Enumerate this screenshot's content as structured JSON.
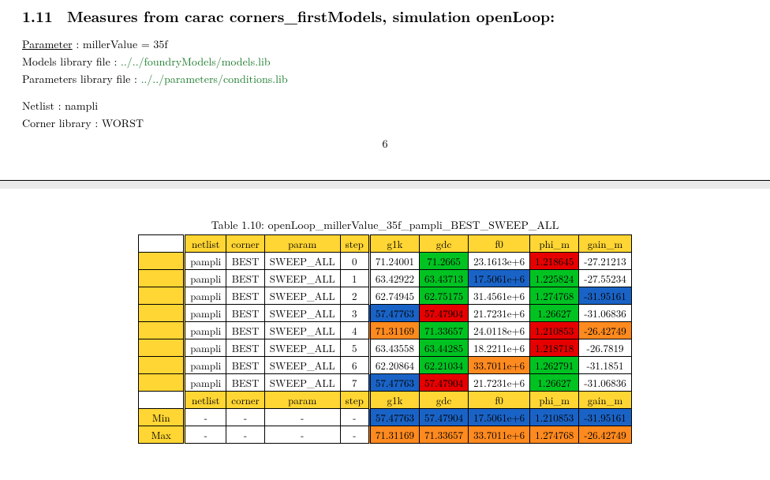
{
  "section": {
    "number": "1.11",
    "title": "Measures from carac corners_firstModels, simulation openLoop:"
  },
  "preamble": {
    "param_label": "Parameter",
    "param_value": "millerValue = 35f",
    "models_label": "Models library file :",
    "models_path": "../../foundryModels/models.lib",
    "params_label": "Parameters library file :",
    "params_path": "../../parameters/conditions.lib",
    "netlist_label": "Netlist : nampli",
    "corner_label": "Corner library : WORST",
    "page_number": "6"
  },
  "table": {
    "caption": "Table 1.10: openLoop_millerValue_35f_pampli_BEST_SWEEP_ALL",
    "headers": [
      "netlist",
      "corner",
      "param",
      "step",
      "g1k",
      "gdc",
      "f0",
      "phi_m",
      "gain_m"
    ],
    "rows": [
      {
        "netlist": "pampli",
        "corner": "BEST",
        "param": "SWEEP_ALL",
        "step": "0",
        "g1k": {
          "v": "71.24001",
          "c": "white"
        },
        "gdc": {
          "v": "71.2665",
          "c": "green"
        },
        "f0": {
          "v": "23.1613e+6",
          "c": "white"
        },
        "phi_m": {
          "v": "1.218645",
          "c": "red"
        },
        "gain_m": {
          "v": "-27.21213",
          "c": "white"
        }
      },
      {
        "netlist": "pampli",
        "corner": "BEST",
        "param": "SWEEP_ALL",
        "step": "1",
        "g1k": {
          "v": "63.42922",
          "c": "white"
        },
        "gdc": {
          "v": "63.43713",
          "c": "green"
        },
        "f0": {
          "v": "17.5061e+6",
          "c": "blue"
        },
        "phi_m": {
          "v": "1.225824",
          "c": "green"
        },
        "gain_m": {
          "v": "-27.55234",
          "c": "white"
        }
      },
      {
        "netlist": "pampli",
        "corner": "BEST",
        "param": "SWEEP_ALL",
        "step": "2",
        "g1k": {
          "v": "62.74945",
          "c": "white"
        },
        "gdc": {
          "v": "62.75175",
          "c": "green"
        },
        "f0": {
          "v": "31.4561e+6",
          "c": "white"
        },
        "phi_m": {
          "v": "1.274768",
          "c": "green"
        },
        "gain_m": {
          "v": "-31.95161",
          "c": "blue"
        }
      },
      {
        "netlist": "pampli",
        "corner": "BEST",
        "param": "SWEEP_ALL",
        "step": "3",
        "g1k": {
          "v": "57.47763",
          "c": "blue"
        },
        "gdc": {
          "v": "57.47904",
          "c": "red"
        },
        "f0": {
          "v": "21.7231e+6",
          "c": "white"
        },
        "phi_m": {
          "v": "1.26627",
          "c": "green"
        },
        "gain_m": {
          "v": "-31.06836",
          "c": "white"
        }
      },
      {
        "netlist": "pampli",
        "corner": "BEST",
        "param": "SWEEP_ALL",
        "step": "4",
        "g1k": {
          "v": "71.31169",
          "c": "orange"
        },
        "gdc": {
          "v": "71.33657",
          "c": "green"
        },
        "f0": {
          "v": "24.0118e+6",
          "c": "white"
        },
        "phi_m": {
          "v": "1.210853",
          "c": "red"
        },
        "gain_m": {
          "v": "-26.42749",
          "c": "orange"
        }
      },
      {
        "netlist": "pampli",
        "corner": "BEST",
        "param": "SWEEP_ALL",
        "step": "5",
        "g1k": {
          "v": "63.43558",
          "c": "white"
        },
        "gdc": {
          "v": "63.44285",
          "c": "green"
        },
        "f0": {
          "v": "18.2211e+6",
          "c": "white"
        },
        "phi_m": {
          "v": "1.218718",
          "c": "red"
        },
        "gain_m": {
          "v": "-26.7819",
          "c": "white"
        }
      },
      {
        "netlist": "pampli",
        "corner": "BEST",
        "param": "SWEEP_ALL",
        "step": "6",
        "g1k": {
          "v": "62.20864",
          "c": "white"
        },
        "gdc": {
          "v": "62.21034",
          "c": "green"
        },
        "f0": {
          "v": "33.7011e+6",
          "c": "orange"
        },
        "phi_m": {
          "v": "1.262791",
          "c": "green"
        },
        "gain_m": {
          "v": "-31.1851",
          "c": "white"
        }
      },
      {
        "netlist": "pampli",
        "corner": "BEST",
        "param": "SWEEP_ALL",
        "step": "7",
        "g1k": {
          "v": "57.47763",
          "c": "blue"
        },
        "gdc": {
          "v": "57.47904",
          "c": "red"
        },
        "f0": {
          "v": "21.7231e+6",
          "c": "white"
        },
        "phi_m": {
          "v": "1.26627",
          "c": "green"
        },
        "gain_m": {
          "v": "-31.06836",
          "c": "white"
        }
      }
    ],
    "summary": {
      "min_label": "Min",
      "max_label": "Max",
      "min": {
        "g1k": "57.47763",
        "gdc": "57.47904",
        "f0": "17.5061e+6",
        "phi_m": "1.210853",
        "gain_m": "-31.95161"
      },
      "max": {
        "g1k": "71.31169",
        "gdc": "71.33657",
        "f0": "33.7011e+6",
        "phi_m": "1.274768",
        "gain_m": "-26.42749"
      }
    }
  }
}
